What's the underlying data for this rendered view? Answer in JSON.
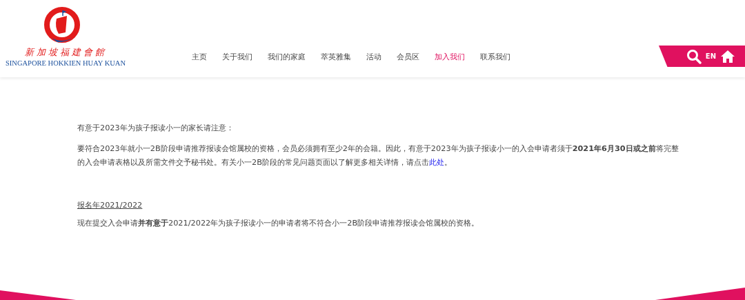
{
  "logo": {
    "chinese_name": "新加坡福建會館",
    "english_name": "SINGAPORE HOKKIEN HUAY KUAN"
  },
  "nav": [
    {
      "label": "主页",
      "selected": false
    },
    {
      "label": "关于我们",
      "selected": false
    },
    {
      "label": "我们的家庭",
      "selected": false
    },
    {
      "label": "萃英雅集",
      "selected": false
    },
    {
      "label": "活动",
      "selected": false
    },
    {
      "label": "会员区",
      "selected": false
    },
    {
      "label": "加入我们",
      "selected": true
    },
    {
      "label": "联系我们",
      "selected": false
    }
  ],
  "tools": {
    "language": "EN"
  },
  "notice": {
    "heading": "有意于2023年为孩子报读小一的家长请注意：",
    "paragraph": "要符合2023年就小一2B阶段申请推荐报读会馆属校的资格，会员必须拥有至少2年的会籍。因此，有意于2023年为孩子报读小一的入会申请者须于**2021年6月30日或之前**将完整的入会申请表格以及所需文件交予秘书处。有关小一2B阶段的常见问题页面以了解更多相关详情，请点击",
    "link": "此处",
    "after": "。"
  },
  "section": {
    "title": "报名年2021/2022",
    "text": "现在提交入会申请**并有意于**2021/2022年为孩子报读小一的申请者将不符合小一2B阶段申请推荐报读会馆属校的资格。"
  }
}
